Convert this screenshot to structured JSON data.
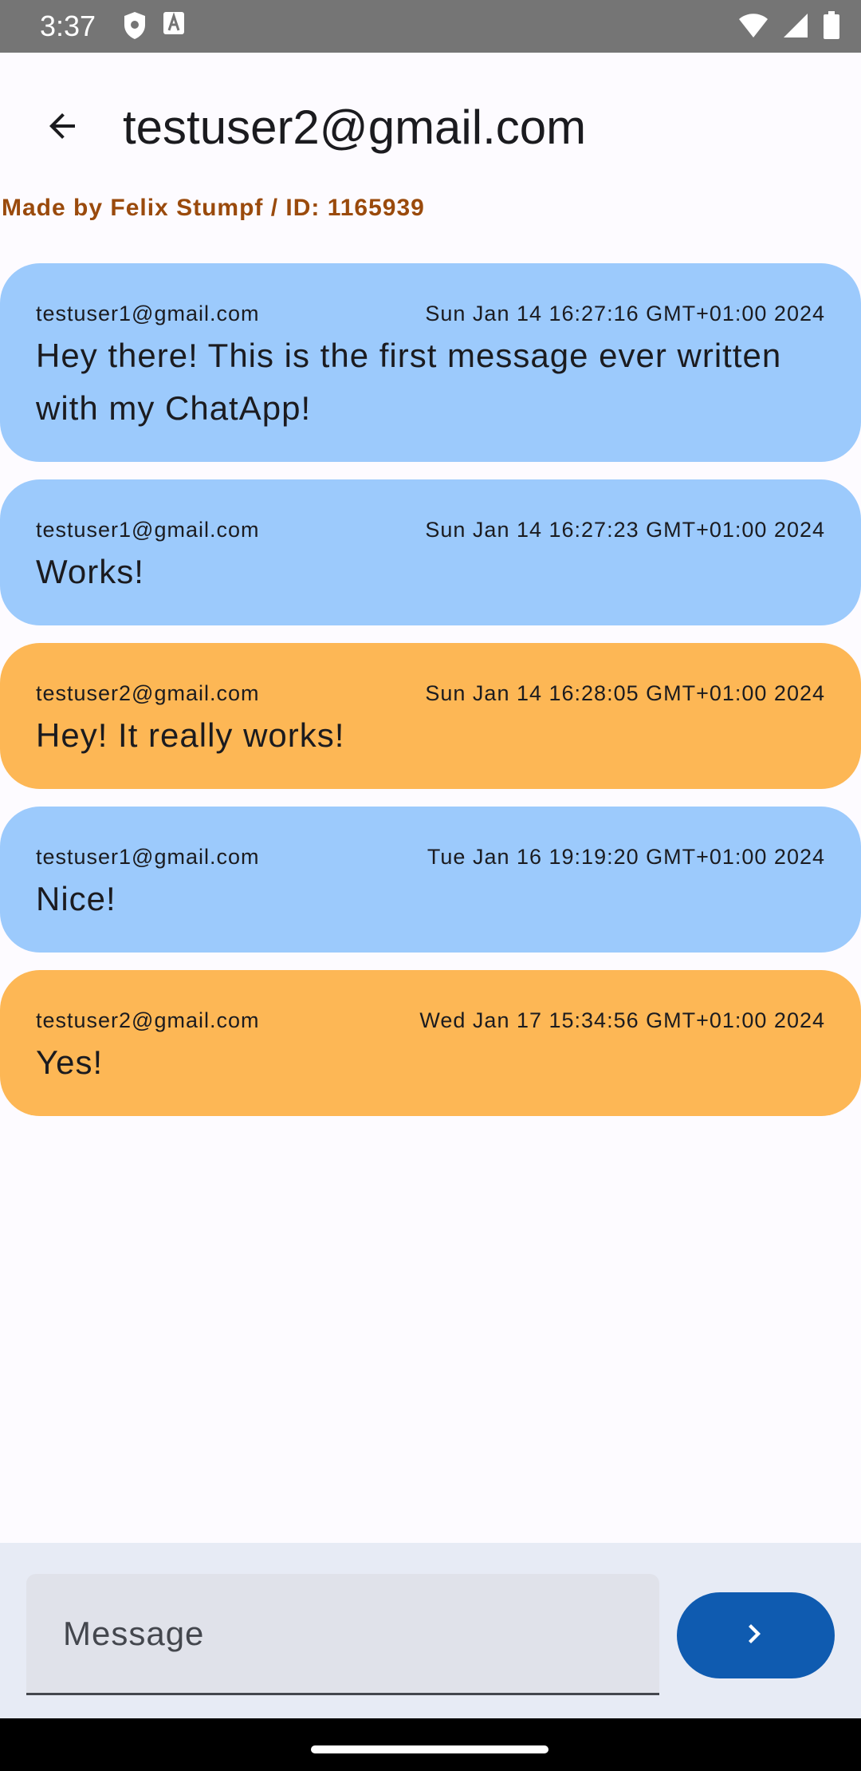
{
  "status_bar": {
    "time": "3:37",
    "icons_left": [
      "shield-icon",
      "text-a-icon"
    ],
    "icons_right": [
      "wifi-icon",
      "signal-icon",
      "battery-icon"
    ]
  },
  "app_bar": {
    "back_icon": "arrow-back-icon",
    "title": "testuser2@gmail.com"
  },
  "credit": "Made by Felix Stumpf / ID: 1165939",
  "colors": {
    "own_message": "#fdb755",
    "other_message": "#9ccafc",
    "credit_text": "#9a4a0c",
    "send_button": "#0f5bb0"
  },
  "messages": [
    {
      "sender": "testuser1@gmail.com",
      "timestamp": "Sun Jan 14 16:27:16 GMT+01:00 2024",
      "text": "Hey there! This is the first message ever written with my ChatApp!"
    },
    {
      "sender": "testuser1@gmail.com",
      "timestamp": "Sun Jan 14 16:27:23 GMT+01:00 2024",
      "text": "Works!"
    },
    {
      "sender": "testuser2@gmail.com",
      "timestamp": "Sun Jan 14 16:28:05 GMT+01:00 2024",
      "text": "Hey! It really works!"
    },
    {
      "sender": "testuser1@gmail.com",
      "timestamp": "Tue Jan 16 19:19:20 GMT+01:00 2024",
      "text": "Nice!"
    },
    {
      "sender": "testuser2@gmail.com",
      "timestamp": "Wed Jan 17 15:34:56 GMT+01:00 2024",
      "text": "Yes!"
    }
  ],
  "composer": {
    "placeholder": "Message",
    "send_icon": "chevron-right-icon"
  }
}
